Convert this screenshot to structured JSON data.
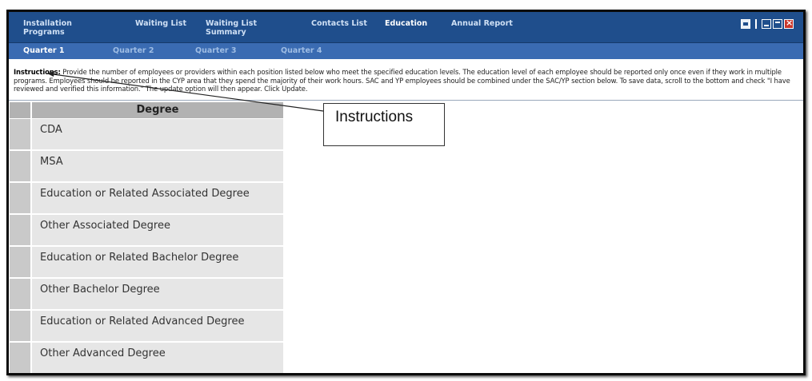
{
  "nav": {
    "items": [
      {
        "label": "Installation\nPrograms"
      },
      {
        "label": "Waiting List"
      },
      {
        "label": "Waiting List\nSummary"
      },
      {
        "label": "Contacts List"
      },
      {
        "label": "Education"
      },
      {
        "label": "Annual Report"
      }
    ],
    "active": "Education"
  },
  "tabs": [
    "Quarter 1",
    "Quarter 2",
    "Quarter 3",
    "Quarter 4"
  ],
  "active_tab": "Quarter 1",
  "instructions": {
    "label": "Instructions:",
    "text": " Provide the number of employees or providers within each position listed below who meet the specified education levels. The education level of each employee should be reported only once even if they work in multiple programs. Employees should be reported in the CYP area that they spend the majority of their work hours. SAC and YP employees should be combined under the SAC/YP section below. To save data, scroll to the bottom and check \"I have reviewed and verified this information.\" The update option will then appear. Click Update."
  },
  "table": {
    "header": "Degree",
    "rows": [
      "CDA",
      "MSA",
      "Education or Related Associated Degree",
      "Other Associated Degree",
      "Education or Related Bachelor Degree",
      "Other Bachelor Degree",
      "Education or Related Advanced Degree",
      "Other Advanced Degree"
    ]
  },
  "callout": {
    "label": "Instructions"
  },
  "icons": {
    "print": "print-icon",
    "minimize": "minimize-icon",
    "maximize": "maximize-icon",
    "close": "close-icon"
  },
  "colors": {
    "nav_bg": "#1f4e8c",
    "tab_bg": "#3a6bb2",
    "row_bg": "#e6e6e6",
    "header_bg": "#b2b2b2"
  }
}
